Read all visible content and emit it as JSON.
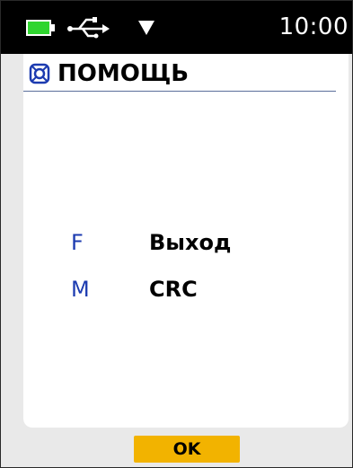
{
  "status_bar": {
    "time": "10:00",
    "battery_icon": "battery-icon",
    "usb_icon": "usb-icon",
    "signal_icon": "signal-icon",
    "background": "#000000"
  },
  "header": {
    "title": "ПОМОЩЬ",
    "icon": "lifebuoy-icon",
    "rule_color": "#5a6f9a"
  },
  "key_list": [
    {
      "key": "F",
      "action": "Выход"
    },
    {
      "key": "M",
      "action": "CRC"
    }
  ],
  "footer": {
    "ok_label": "OK",
    "ok_color": "#f2b300"
  },
  "colors": {
    "key_letter": "#1c3bb0",
    "battery": "#2fd52f",
    "device_background": "#e9e9e9"
  }
}
